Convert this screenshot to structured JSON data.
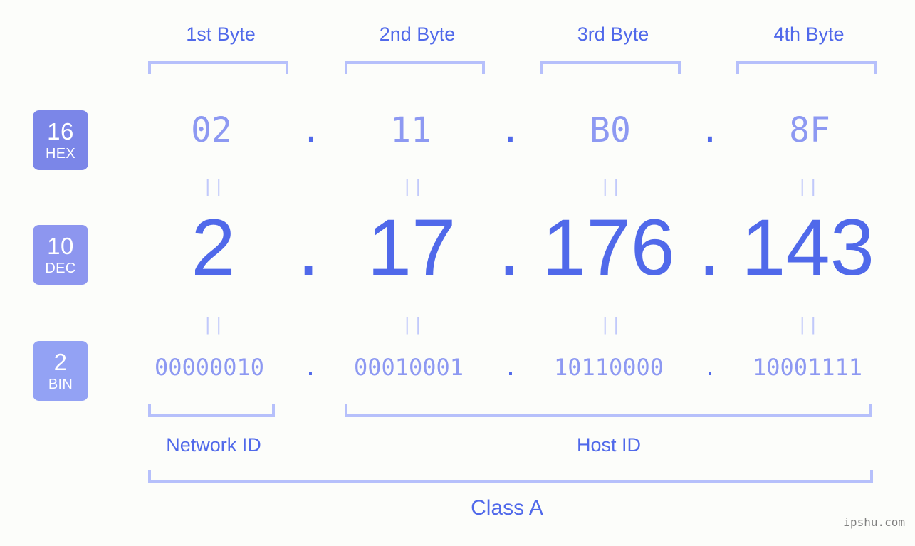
{
  "meta": {
    "ip_decimal": "2.17.176.143",
    "ip_class": "Class A",
    "watermark": "ipshu.com",
    "colors": {
      "background": "#fcfdfa",
      "accent_strong": "#5069ea",
      "accent_soft": "#8d99f2",
      "bracket": "#b6c0fb",
      "badge_fill": "#7b86e8",
      "equals": "#c1c9fb",
      "watermark": "#808080"
    }
  },
  "byte_headers": [
    {
      "label": "1st Byte"
    },
    {
      "label": "2nd Byte"
    },
    {
      "label": "3rd Byte"
    },
    {
      "label": "4th Byte"
    }
  ],
  "rows": {
    "hex": {
      "badge_number": "16",
      "badge_name": "HEX",
      "values": [
        "02",
        "11",
        "B0",
        "8F"
      ],
      "separator": "."
    },
    "dec": {
      "badge_number": "10",
      "badge_name": "DEC",
      "values": [
        "2",
        "17",
        "176",
        "143"
      ],
      "separator": "."
    },
    "bin": {
      "badge_number": "2",
      "badge_name": "BIN",
      "values": [
        "00000010",
        "00010001",
        "10110000",
        "10001111"
      ],
      "separator": "."
    }
  },
  "equals_marks": {
    "glyph": "||",
    "hex_to_dec": [
      "||",
      "||",
      "||",
      "||"
    ],
    "dec_to_bin": [
      "||",
      "||",
      "||",
      "||"
    ]
  },
  "footer": {
    "network_id_label": "Network ID",
    "host_id_label": "Host ID",
    "class_label": "Class A"
  }
}
